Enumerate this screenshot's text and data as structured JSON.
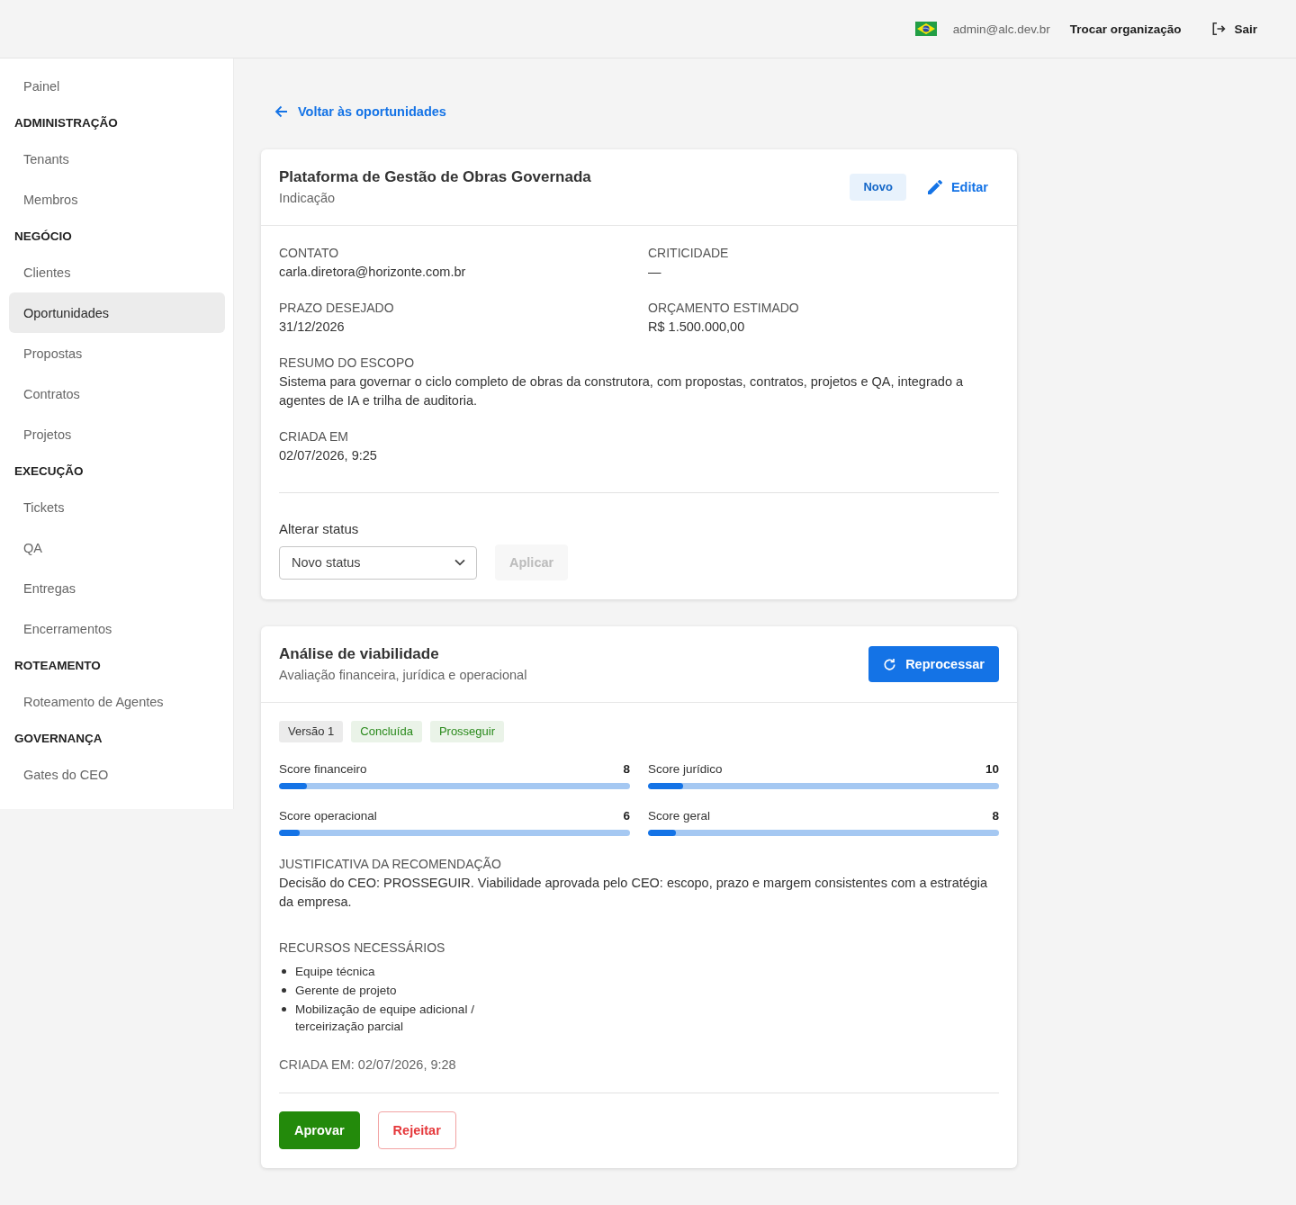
{
  "header": {
    "user_email": "admin@alc.dev.br",
    "switch_org": "Trocar organização",
    "logout": "Sair"
  },
  "sidebar": {
    "items": [
      {
        "label": "Painel",
        "selected": false
      }
    ],
    "sections": [
      {
        "title": "ADMINISTRAÇÃO",
        "items": [
          {
            "label": "Tenants",
            "selected": false
          },
          {
            "label": "Membros",
            "selected": false
          }
        ]
      },
      {
        "title": "NEGÓCIO",
        "items": [
          {
            "label": "Clientes",
            "selected": false
          },
          {
            "label": "Oportunidades",
            "selected": true
          },
          {
            "label": "Propostas",
            "selected": false
          },
          {
            "label": "Contratos",
            "selected": false
          },
          {
            "label": "Projetos",
            "selected": false
          }
        ]
      },
      {
        "title": "EXECUÇÃO",
        "items": [
          {
            "label": "Tickets",
            "selected": false
          },
          {
            "label": "QA",
            "selected": false
          },
          {
            "label": "Entregas",
            "selected": false
          },
          {
            "label": "Encerramentos",
            "selected": false
          }
        ]
      },
      {
        "title": "ROTEAMENTO",
        "items": [
          {
            "label": "Roteamento de Agentes",
            "selected": false
          }
        ]
      },
      {
        "title": "GOVERNANÇA",
        "items": [
          {
            "label": "Gates do CEO",
            "selected": false
          }
        ]
      }
    ]
  },
  "back_link": "Voltar às oportunidades",
  "opportunity": {
    "title": "Plataforma de Gestão de Obras Governada",
    "source": "Indicação",
    "status_badge": "Novo",
    "edit_button": "Editar",
    "fields": [
      {
        "label": "CONTATO",
        "value": "carla.diretora@horizonte.com.br"
      },
      {
        "label": "CRITICIDADE",
        "value": "—"
      },
      {
        "label": "PRAZO DESEJADO",
        "value": "31/12/2026"
      },
      {
        "label": "ORÇAMENTO ESTIMADO",
        "value": "R$ 1.500.000,00"
      }
    ],
    "full_fields": [
      {
        "label": "RESUMO DO ESCOPO",
        "value": "Sistema para governar o ciclo completo de obras da construtora, com propostas, contratos, projetos e QA, integrado a agentes de IA e trilha de auditoria."
      },
      {
        "label": "CRIADA EM",
        "value": "02/07/2026, 9:25"
      }
    ],
    "status_change": {
      "label": "Alterar status",
      "select": {
        "placeholder": "Novo status"
      },
      "apply_button": {
        "label": "Aplicar",
        "disabled": true
      }
    }
  },
  "feasibility": {
    "title": "Análise de viabilidade",
    "subtitle": "Avaliação financeira, jurídica e operacional",
    "reprocess_button": "Reprocessar",
    "tags": [
      {
        "label": "Versão 1",
        "color": "#333333"
      },
      {
        "label": "Concluída",
        "color": "#2a8a1c"
      },
      {
        "label": "Prosseguir",
        "color": "#2a8a1c"
      }
    ],
    "scores": [
      {
        "label": "Score financeiro",
        "value": "8",
        "level": 0.08
      },
      {
        "label": "Score jurídico",
        "value": "10",
        "level": 0.1
      },
      {
        "label": "Score operacional",
        "value": "6",
        "level": 0.06
      },
      {
        "label": "Score geral",
        "value": "8",
        "level": 0.08
      }
    ],
    "justification": {
      "label": "JUSTIFICATIVA DA RECOMENDAÇÃO",
      "text": "Decisão do CEO: PROSSEGUIR. Viabilidade aprovada pelo CEO: escopo, prazo e margem consistentes com a estratégia da empresa."
    },
    "resources": {
      "label": "RECURSOS NECESSÁRIOS",
      "items": [
        "Equipe técnica",
        "Gerente de projeto",
        "Mobilização de equipe adicional / terceirização parcial"
      ]
    },
    "created": "CRIADA EM: 02/07/2026, 9:28",
    "actions": [
      {
        "label": "Aprovar",
        "kind": "approve"
      },
      {
        "label": "Rejeitar",
        "kind": "reject"
      }
    ]
  }
}
